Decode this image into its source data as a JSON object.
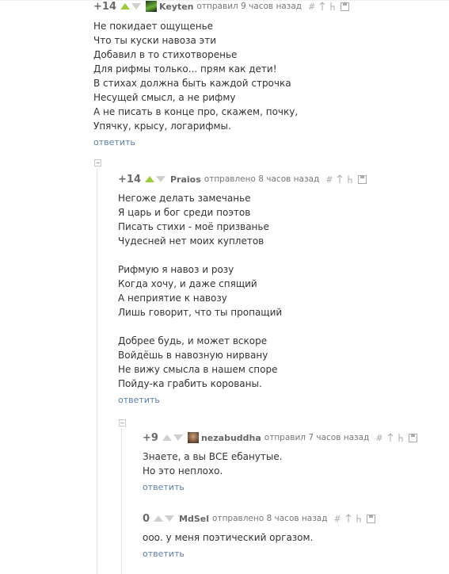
{
  "comments": [
    {
      "rating": "+14",
      "author": "Keyten",
      "meta": "отправил 9 часов назад",
      "lines": [
        "Не покидает ощущенье",
        "Что ты куски навоза эти",
        "Добавил в то стихотворенье",
        "Для рифмы только... прям как дети!",
        "В стихах должна быть каждой строчка",
        "Несущей смысл, а не рифму",
        "А не писать в конце про, скажем, почку,",
        "Упячку, крысу, логарифмы."
      ],
      "reply": "ответить"
    },
    {
      "rating": "+14",
      "author": "Praios",
      "meta": "отправлено 8 часов назад",
      "lines": [
        "Негоже делать замечанье",
        "Я царь и бог среди поэтов",
        "Писать стихи - моё призванье",
        "Чудесней нет моих куплетов",
        "",
        "Рифмую я навоз и розу",
        "Когда хочу, и даже спящий",
        "А неприятие к навозу",
        "Лишь говорит, что ты пропащий",
        "",
        "Добрее будь, и может вскоре",
        "Войдёшь в навозную нирвану",
        "Не вижу смысла в нашем споре",
        "Пойду-ка грабить корованы."
      ],
      "reply": "ответить"
    },
    {
      "rating": "+9",
      "author": "nezabuddha",
      "meta": "отправил 7 часов назад",
      "lines": [
        "Знаете, а вы ВСЕ ебанутые.",
        "Но это неплохо."
      ],
      "reply": "ответить"
    },
    {
      "rating": "0",
      "author": "MdSel",
      "meta": "отправлено 8 часов назад",
      "lines": [
        "ооо. у меня поэтический оргазом."
      ],
      "reply": "ответить"
    }
  ],
  "tool_icons": [
    "hash-icon",
    "pin-icon",
    "branch-icon",
    "save-icon"
  ],
  "colors": {
    "vote_up": "#9ecb3c",
    "vote_neutral": "#cfcfcf",
    "link": "#5a7fa7"
  }
}
